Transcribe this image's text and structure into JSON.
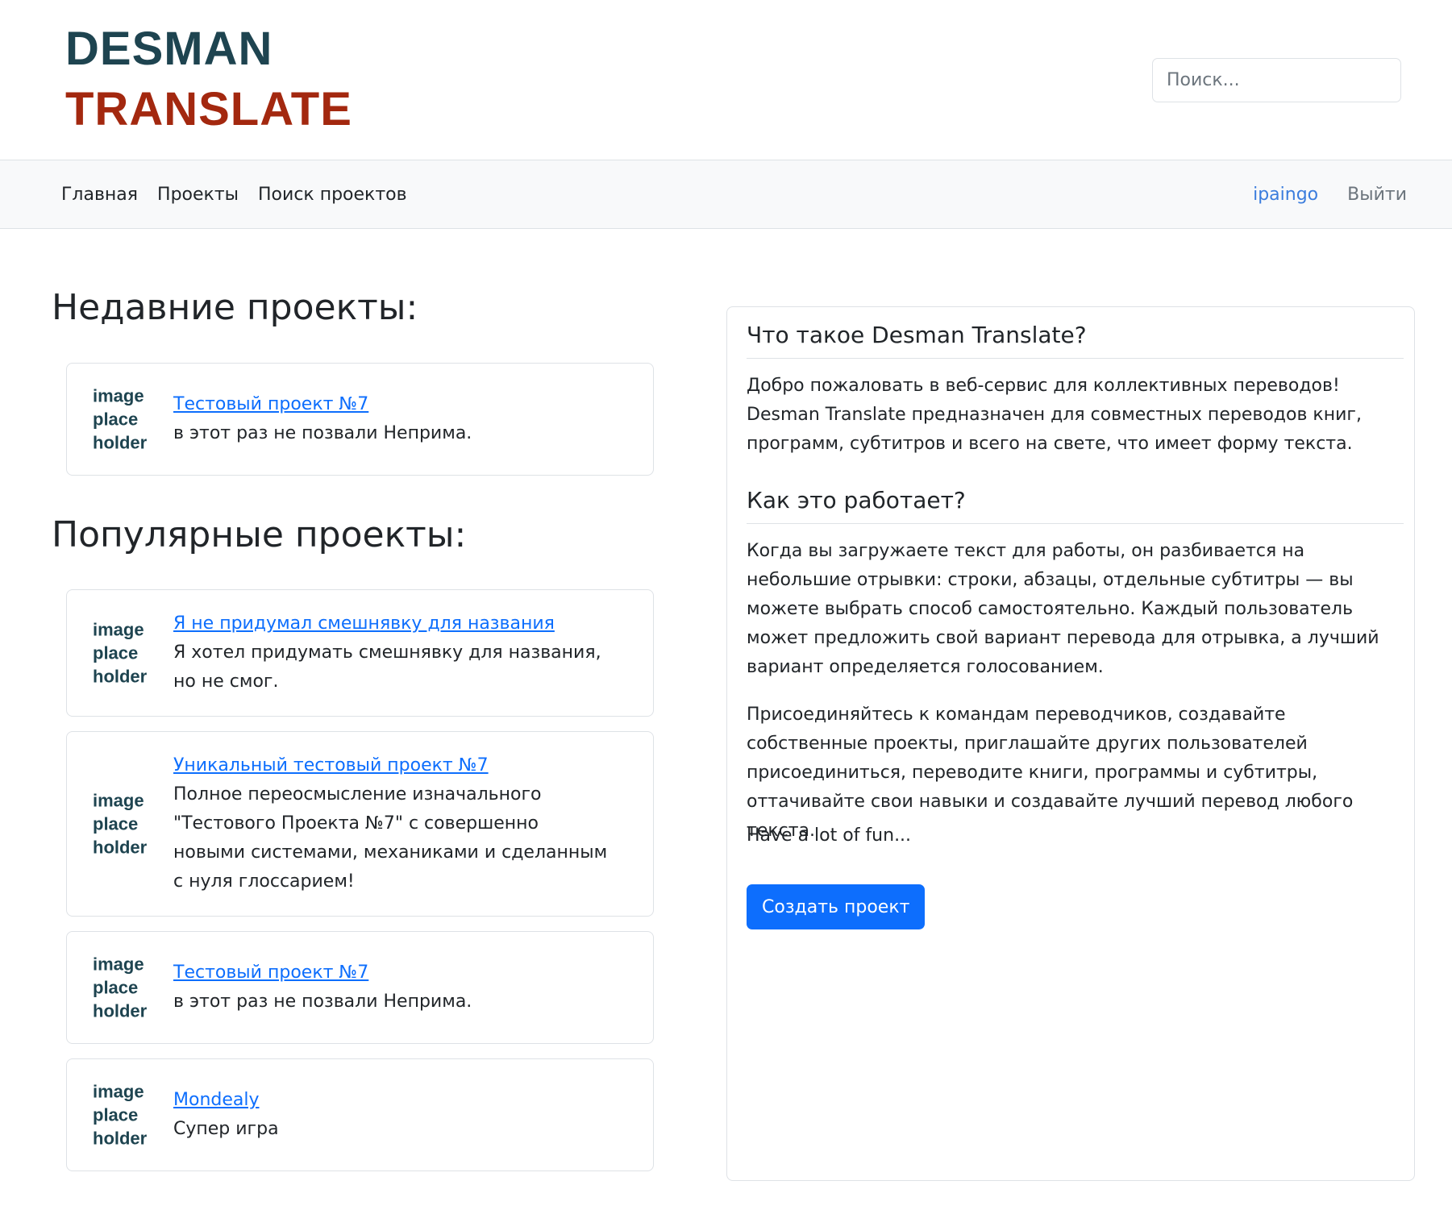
{
  "header": {
    "logo_line1": "DESMAN",
    "logo_line2": "TRANSLATE",
    "search_placeholder": "Поиск..."
  },
  "nav": {
    "items": [
      {
        "label": "Главная"
      },
      {
        "label": "Проекты"
      },
      {
        "label": "Поиск проектов"
      }
    ],
    "user": "ipaingo",
    "logout": "Выйти"
  },
  "recent": {
    "title": "Недавние проекты:",
    "projects": [
      {
        "image_text": "image place holder",
        "name": "Тестовый проект №7",
        "description": "в этот раз не позвали Неприма."
      }
    ]
  },
  "popular": {
    "title": "Популярные проекты:",
    "projects": [
      {
        "image_text": "image place holder",
        "name": "Я не придумал смешнявку для названия",
        "description": "Я хотел придумать смешнявку для названия, но не смог."
      },
      {
        "image_text": "image place holder",
        "name": "Уникальный тестовый проект №7",
        "description": "Полное переосмысление изначального \"Тестового Проекта №7\" с совершенно новыми системами, механиками и сделанным с нуля глоссарием!"
      },
      {
        "image_text": "image place holder",
        "name": "Тестовый проект №7",
        "description": "в этот раз не позвали Неприма."
      },
      {
        "image_text": "image place holder",
        "name": "Mondealy",
        "description": "Супер игра"
      }
    ]
  },
  "info": {
    "heading1": "Что такое Desman Translate?",
    "paragraph1": "Добро пожаловать в веб-сервис для коллективных переводов! Desman Translate предназначен для совместных переводов книг, программ, субтитров и всего на свете, что имеет форму текста.",
    "heading2": "Как это работает?",
    "paragraph2": "Когда вы загружаете текст для работы, он разбивается на небольшие отрывки: строки, абзацы, отдельные субтитры — вы можете выбрать способ самостоятельно. Каждый пользователь может предложить свой вариант перевода для отрывка, а лучший вариант определяется голосованием.",
    "paragraph3": "Присоединяйтесь к командам переводчиков, создавайте собственные проекты, приглашайте других пользователей присоединиться, переводите книги, программы и субтитры, оттачивайте свои навыки и создавайте лучший перевод любого текста.",
    "paragraph4": "Have a lot of fun...",
    "create_button": "Создать проект"
  }
}
